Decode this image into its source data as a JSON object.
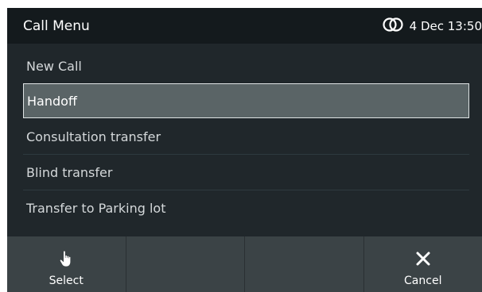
{
  "header": {
    "title": "Call Menu",
    "status_icon": "link-rings-icon",
    "datetime": "4 Dec 13:50"
  },
  "menu": {
    "items": [
      {
        "label": "New Call"
      },
      {
        "label": "Handoff",
        "selected": true
      },
      {
        "label": "Consultation transfer"
      },
      {
        "label": "Blind transfer"
      },
      {
        "label": "Transfer to Parking lot"
      }
    ]
  },
  "softkeys": [
    {
      "label": "Select",
      "icon": "hand-pointer-icon"
    },
    {
      "label": ""
    },
    {
      "label": ""
    },
    {
      "label": "Cancel",
      "icon": "close-icon"
    }
  ],
  "colors": {
    "background": "#20272b",
    "header": "#141a1d",
    "selected_row": "#5a6466",
    "softkey_bar": "#3b4346"
  }
}
